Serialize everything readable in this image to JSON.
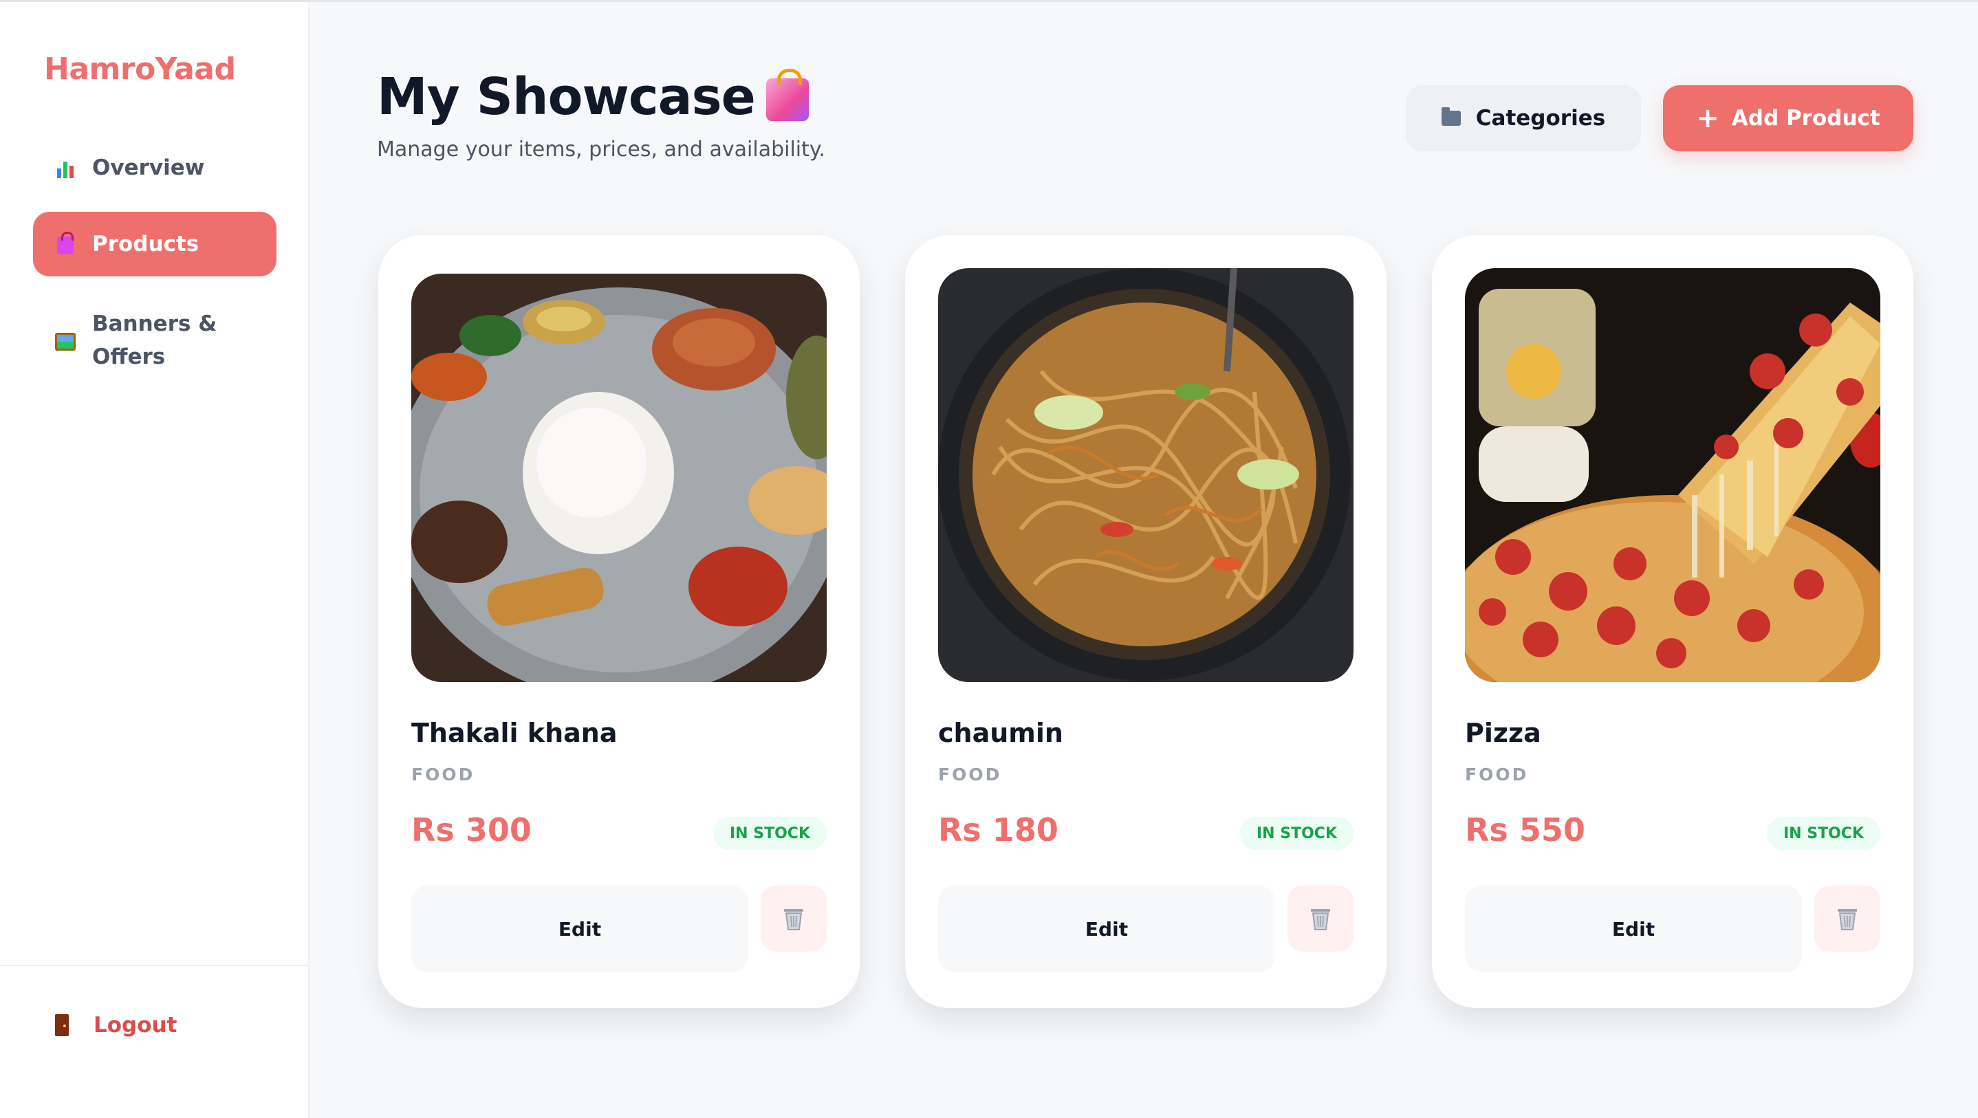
{
  "app": {
    "brand": "HamroYaad"
  },
  "sidebar": {
    "items": [
      {
        "label": "Overview",
        "icon": "bar-chart-icon",
        "active": false
      },
      {
        "label": "Products",
        "icon": "shopping-bags-icon",
        "active": true
      },
      {
        "label_line1": "Banners &",
        "label_line2": "Offers",
        "icon": "framed-picture-icon",
        "active": false
      }
    ],
    "logout": {
      "label": "Logout",
      "icon": "door-icon"
    }
  },
  "header": {
    "title": "My Showcase",
    "subtitle": "Manage your items, prices, and availability.",
    "categories_button": "Categories",
    "add_button": "Add Product"
  },
  "products": [
    {
      "name": "Thakali khana",
      "category": "FOOD",
      "price": "Rs 300",
      "stock": "IN STOCK",
      "edit": "Edit",
      "image": "thakali-khana-photo"
    },
    {
      "name": "chaumin",
      "category": "FOOD",
      "price": "Rs 180",
      "stock": "IN STOCK",
      "edit": "Edit",
      "image": "chaumin-photo"
    },
    {
      "name": "Pizza",
      "category": "FOOD",
      "price": "Rs 550",
      "stock": "IN STOCK",
      "edit": "Edit",
      "image": "pizza-photo"
    }
  ],
  "colors": {
    "accent": "#ef6f6c",
    "stock_text": "#16a34a",
    "stock_bg": "#ecfdf3",
    "background": "#f7f8fa"
  }
}
